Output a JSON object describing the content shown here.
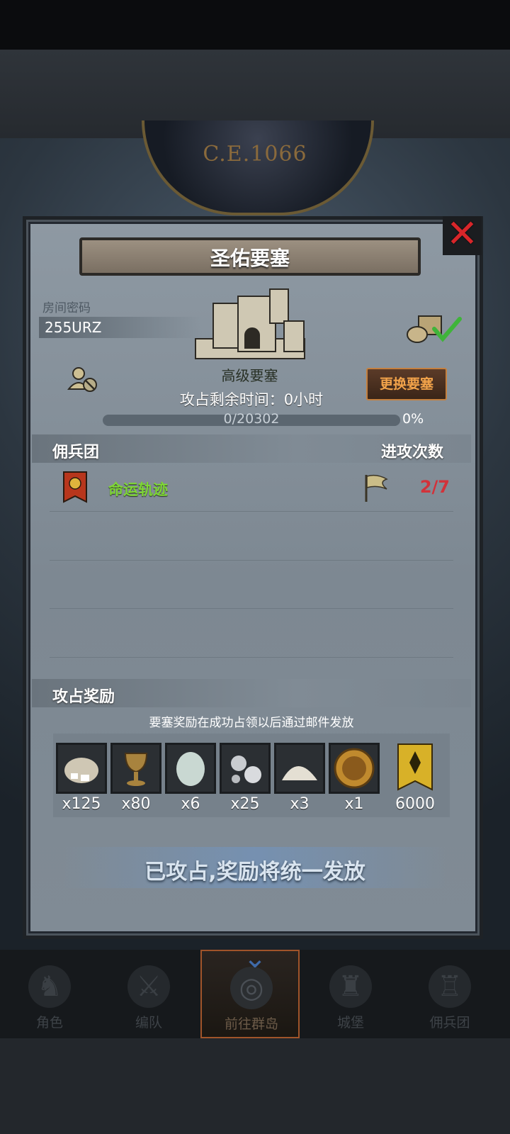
{
  "header": {
    "era": "C.E.1066"
  },
  "dialog": {
    "title": "圣佑要塞",
    "room_label": "房间密码",
    "room_code": "255URZ",
    "fortress_name": "高级要塞",
    "change_button": "更换要塞",
    "timer_text": "攻占剩余时间：0小时",
    "progress": {
      "current": 0,
      "total": 20302,
      "text": "0/20302",
      "percent_text": "0%"
    },
    "mercenary_header": "佣兵团",
    "attack_header": "进攻次数",
    "guilds": [
      {
        "name": "命运轨迹",
        "attacks": "2/7"
      }
    ],
    "reward_header": "攻占奖励",
    "reward_note": "要塞奖励在成功占领以后通过邮件发放",
    "rewards": [
      {
        "icon": "salt-bag-icon",
        "qty": "x125"
      },
      {
        "icon": "goblet-icon",
        "qty": "x80"
      },
      {
        "icon": "moonstone-icon",
        "qty": "x6"
      },
      {
        "icon": "silver-ore-icon",
        "qty": "x25"
      },
      {
        "icon": "flour-pile-icon",
        "qty": "x3"
      },
      {
        "icon": "knight-medal-icon",
        "qty": "x1"
      },
      {
        "icon": "rank-banner-icon",
        "qty": "6000"
      }
    ],
    "claimed_text": "已攻占,奖励将统一发放"
  },
  "nav": {
    "items": [
      {
        "label": "角色"
      },
      {
        "label": "编队"
      },
      {
        "label": "前往群岛"
      },
      {
        "label": "城堡"
      },
      {
        "label": "佣兵团"
      }
    ],
    "active_index": 2
  },
  "colors": {
    "accent_orange": "#f2a34a",
    "guild_green": "#7ed636",
    "count_red": "#d2323a",
    "close_red": "#d8262a"
  }
}
